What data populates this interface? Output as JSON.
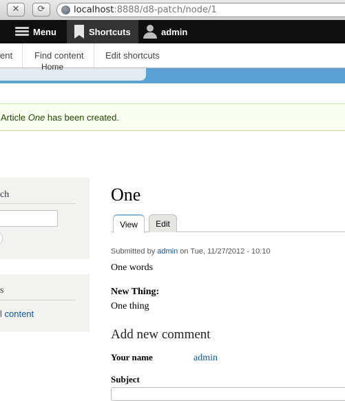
{
  "browser": {
    "url_host": "localhost",
    "url_path": ":8888/d8-patch/node/1",
    "close_glyph": "✕",
    "reload_glyph": "⟳"
  },
  "toolbar": {
    "menu_label": "Menu",
    "shortcuts_label": "Shortcuts",
    "user_label": "admin"
  },
  "tray": {
    "items": [
      "ent",
      "Find content",
      "Edit shortcuts"
    ]
  },
  "header": {
    "home_label": "Home"
  },
  "status": {
    "prefix": "Article ",
    "title": "One",
    "suffix": " has been created."
  },
  "sidebar": {
    "search_title": "ch",
    "tools_title": "s",
    "tools_link": "l content"
  },
  "node": {
    "title": "One",
    "tabs": [
      "View",
      "Edit"
    ],
    "submitted_prefix": "Submitted by ",
    "author": "admin",
    "submitted_suffix": " on Tue, 11/27/2012 - 10:10",
    "body": "One words",
    "field_label": "New Thing:",
    "field_value": "One thing"
  },
  "comment_form": {
    "heading": "Add new comment",
    "name_label": "Your name",
    "name_value": "admin",
    "subject_label": "Subject"
  },
  "colors": {
    "toolbar_bg": "#0f0f0f",
    "header_blue": "#5aa1d6",
    "link": "#0a59a3",
    "status_bg": "#f8fff0",
    "status_border": "#c9e6a1"
  }
}
